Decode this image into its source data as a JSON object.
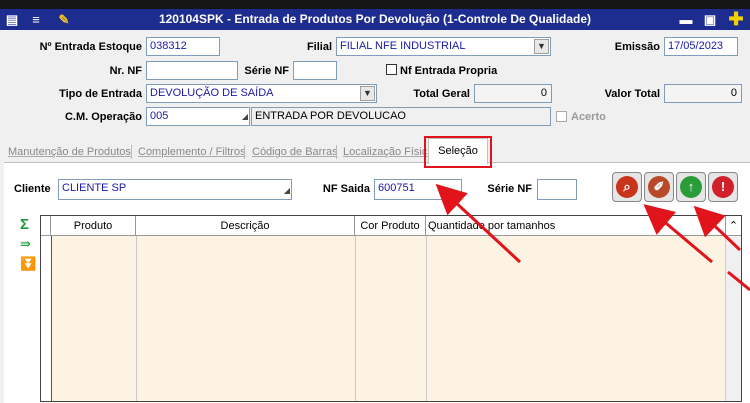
{
  "window": {
    "title": "120104SPK - Entrada de Produtos Por Devolução (1-Controle De Qualidade)"
  },
  "form": {
    "entrada_estoque": {
      "label": "Nº Entrada Estoque",
      "value": "038312"
    },
    "filial": {
      "label": "Filial",
      "value": "FILIAL NFE INDUSTRIAL"
    },
    "emissao": {
      "label": "Emissão",
      "value": "17/05/2023"
    },
    "nr_nf": {
      "label": "Nr. NF",
      "value": ""
    },
    "serie_nf": {
      "label": "Série NF",
      "value": ""
    },
    "nf_entrada_propria": {
      "label": "Nf Entrada Propria",
      "checked": false
    },
    "tipo_entrada": {
      "label": "Tipo de Entrada",
      "value": "DEVOLUÇÃO DE SAÍDA"
    },
    "total_geral": {
      "label": "Total Geral",
      "value": "0"
    },
    "valor_total": {
      "label": "Valor Total",
      "value": "0"
    },
    "cm_operacao": {
      "label": "C.M. Operação",
      "code": "005",
      "description": "ENTRADA POR DEVOLUCAO"
    },
    "acerto": {
      "label": "Acerto",
      "checked": false
    }
  },
  "tabs": [
    {
      "label": "Manutenção de Produtos"
    },
    {
      "label": "Complemento / Filtros"
    },
    {
      "label": "Código de Barras"
    },
    {
      "label": "Localização Física"
    },
    {
      "label": "Seleção",
      "active": true
    }
  ],
  "selecao": {
    "cliente": {
      "label": "Cliente",
      "value": "CLIENTE SP"
    },
    "nf_saida": {
      "label": "NF Saida",
      "value": "600751"
    },
    "serie_nf": {
      "label": "Série NF",
      "value": ""
    },
    "grid_columns": [
      "Produto",
      "Descrição",
      "Cor Produto",
      "Quantidade por tamanhos"
    ]
  },
  "icons": {
    "search": "search-icon",
    "eraser": "eraser-icon",
    "confirm": "arrow-up-icon",
    "stop": "stop-icon"
  },
  "colors": {
    "title_bar": "#1c2c8f",
    "input_text": "#1a1aa6",
    "annotation": "#e0141a",
    "grid_bg": "#fcf3e2"
  }
}
